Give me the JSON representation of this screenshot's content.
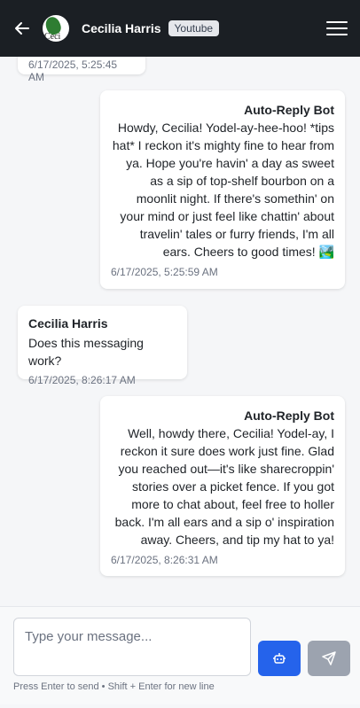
{
  "header": {
    "avatar_alt": "Ceci",
    "contact_name": "Cecilia Harris",
    "platform_badge": "Youtube",
    "back_icon": "arrow-left-icon",
    "menu_icon": "hamburger-menu-icon"
  },
  "messages": [
    {
      "direction": "in",
      "sender": "",
      "text": "",
      "time": "6/17/2025, 5:25:45 AM"
    },
    {
      "direction": "out",
      "sender": "Auto-Reply Bot",
      "text": "Howdy, Cecilia! Yodel-ay-hee-hoo! *tips hat* I reckon it's mighty fine to hear from ya. Hope you're havin' a day as sweet as a sip of top-shelf bourbon on a moonlit night. If there's somethin' on your mind or just feel like chattin' about travelin' tales or furry friends, I'm all ears. Cheers to good times! 🏞️",
      "time": "6/17/2025, 5:25:59 AM"
    },
    {
      "direction": "in",
      "sender": "Cecilia Harris",
      "text": "Does this messaging work?",
      "time": "6/17/2025, 8:26:17 AM"
    },
    {
      "direction": "out",
      "sender": "Auto-Reply Bot",
      "text": "Well, howdy there, Cecilia! Yodel-ay, I reckon it sure does work just fine. Glad you reached out—it's like sharecroppin' stories over a picket fence. If you got more to chat about, feel free to holler back. I'm all ears and a sip o' inspiration away. Cheers, and tip my hat to ya!",
      "time": "6/17/2025, 8:26:31 AM"
    }
  ],
  "composer": {
    "placeholder": "Type your message...",
    "hint": "Press Enter to send • Shift + Enter for new line",
    "bot_icon": "robot-icon",
    "send_icon": "send-icon"
  },
  "colors": {
    "header_bg": "#1b1f24",
    "bot_button": "#2563eb",
    "send_button_disabled": "#9ca3af"
  }
}
